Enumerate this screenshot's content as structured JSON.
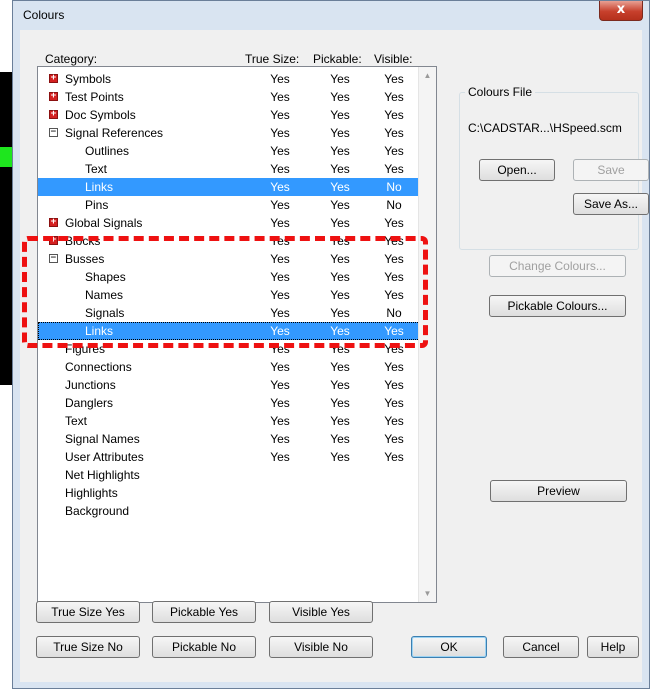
{
  "dialog": {
    "title": "Colours",
    "close_glyph": "x"
  },
  "list": {
    "headers": {
      "category": "Category:",
      "true_size": "True Size:",
      "pickable": "Pickable:",
      "visible": "Visible:"
    },
    "rows": [
      {
        "name": "Symbols",
        "indent": 0,
        "expander": "plus",
        "true_size": "Yes",
        "pickable": "Yes",
        "visible": "Yes"
      },
      {
        "name": "Test Points",
        "indent": 0,
        "expander": "plus",
        "true_size": "Yes",
        "pickable": "Yes",
        "visible": "Yes"
      },
      {
        "name": "Doc Symbols",
        "indent": 0,
        "expander": "plus",
        "true_size": "Yes",
        "pickable": "Yes",
        "visible": "Yes"
      },
      {
        "name": "Signal References",
        "indent": 0,
        "expander": "minus",
        "true_size": "Yes",
        "pickable": "Yes",
        "visible": "Yes"
      },
      {
        "name": "Outlines",
        "indent": 1,
        "expander": "",
        "true_size": "Yes",
        "pickable": "Yes",
        "visible": "Yes"
      },
      {
        "name": "Text",
        "indent": 1,
        "expander": "",
        "true_size": "Yes",
        "pickable": "Yes",
        "visible": "Yes"
      },
      {
        "name": "Links",
        "indent": 1,
        "expander": "",
        "true_size": "Yes",
        "pickable": "Yes",
        "visible": "No",
        "selected": true
      },
      {
        "name": "Pins",
        "indent": 1,
        "expander": "",
        "true_size": "Yes",
        "pickable": "Yes",
        "visible": "No"
      },
      {
        "name": "Global Signals",
        "indent": 0,
        "expander": "plus",
        "true_size": "Yes",
        "pickable": "Yes",
        "visible": "Yes"
      },
      {
        "name": "Blocks",
        "indent": 0,
        "expander": "plus",
        "true_size": "Yes",
        "pickable": "Yes",
        "visible": "Yes"
      },
      {
        "name": "Busses",
        "indent": 0,
        "expander": "minus",
        "true_size": "Yes",
        "pickable": "Yes",
        "visible": "Yes"
      },
      {
        "name": "Shapes",
        "indent": 1,
        "expander": "",
        "true_size": "Yes",
        "pickable": "Yes",
        "visible": "Yes"
      },
      {
        "name": "Names",
        "indent": 1,
        "expander": "",
        "true_size": "Yes",
        "pickable": "Yes",
        "visible": "Yes"
      },
      {
        "name": "Signals",
        "indent": 1,
        "expander": "",
        "true_size": "Yes",
        "pickable": "Yes",
        "visible": "No"
      },
      {
        "name": "Links",
        "indent": 1,
        "expander": "",
        "true_size": "Yes",
        "pickable": "Yes",
        "visible": "Yes",
        "selected": true,
        "focused": true
      },
      {
        "name": "Figures",
        "indent": 0,
        "expander": "",
        "true_size": "Yes",
        "pickable": "Yes",
        "visible": "Yes"
      },
      {
        "name": "Connections",
        "indent": 0,
        "expander": "",
        "true_size": "Yes",
        "pickable": "Yes",
        "visible": "Yes"
      },
      {
        "name": "Junctions",
        "indent": 0,
        "expander": "",
        "true_size": "Yes",
        "pickable": "Yes",
        "visible": "Yes"
      },
      {
        "name": "Danglers",
        "indent": 0,
        "expander": "",
        "true_size": "Yes",
        "pickable": "Yes",
        "visible": "Yes"
      },
      {
        "name": "Text",
        "indent": 0,
        "expander": "",
        "true_size": "Yes",
        "pickable": "Yes",
        "visible": "Yes"
      },
      {
        "name": "Signal Names",
        "indent": 0,
        "expander": "",
        "true_size": "Yes",
        "pickable": "Yes",
        "visible": "Yes"
      },
      {
        "name": "User Attributes",
        "indent": 0,
        "expander": "",
        "true_size": "Yes",
        "pickable": "Yes",
        "visible": "Yes"
      },
      {
        "name": "Net Highlights",
        "indent": 0,
        "expander": "",
        "true_size": "",
        "pickable": "",
        "visible": ""
      },
      {
        "name": "Highlights",
        "indent": 0,
        "expander": "",
        "true_size": "",
        "pickable": "",
        "visible": ""
      },
      {
        "name": "Background",
        "indent": 0,
        "expander": "",
        "true_size": "",
        "pickable": "",
        "visible": ""
      }
    ]
  },
  "colours_file": {
    "label": "Colours File",
    "path": "C:\\CADSTAR...\\HSpeed.scm",
    "open": "Open...",
    "save": "Save",
    "save_as": "Save As..."
  },
  "buttons": {
    "change_colours": "Change Colours...",
    "pickable_colours": "Pickable Colours...",
    "preview": "Preview",
    "true_size_yes": "True Size Yes",
    "pickable_yes": "Pickable Yes",
    "visible_yes": "Visible Yes",
    "true_size_no": "True Size No",
    "pickable_no": "Pickable No",
    "visible_no": "Visible No",
    "ok": "OK",
    "cancel": "Cancel",
    "help": "Help"
  },
  "colors": {
    "selection": "#3399ff",
    "expander_plus": "#d42020",
    "annotation": "#ee1111",
    "side_marker": "#1ee61e"
  },
  "icons": {
    "expand": "plus-box-icon",
    "collapse": "minus-box-icon",
    "close": "close-icon"
  }
}
